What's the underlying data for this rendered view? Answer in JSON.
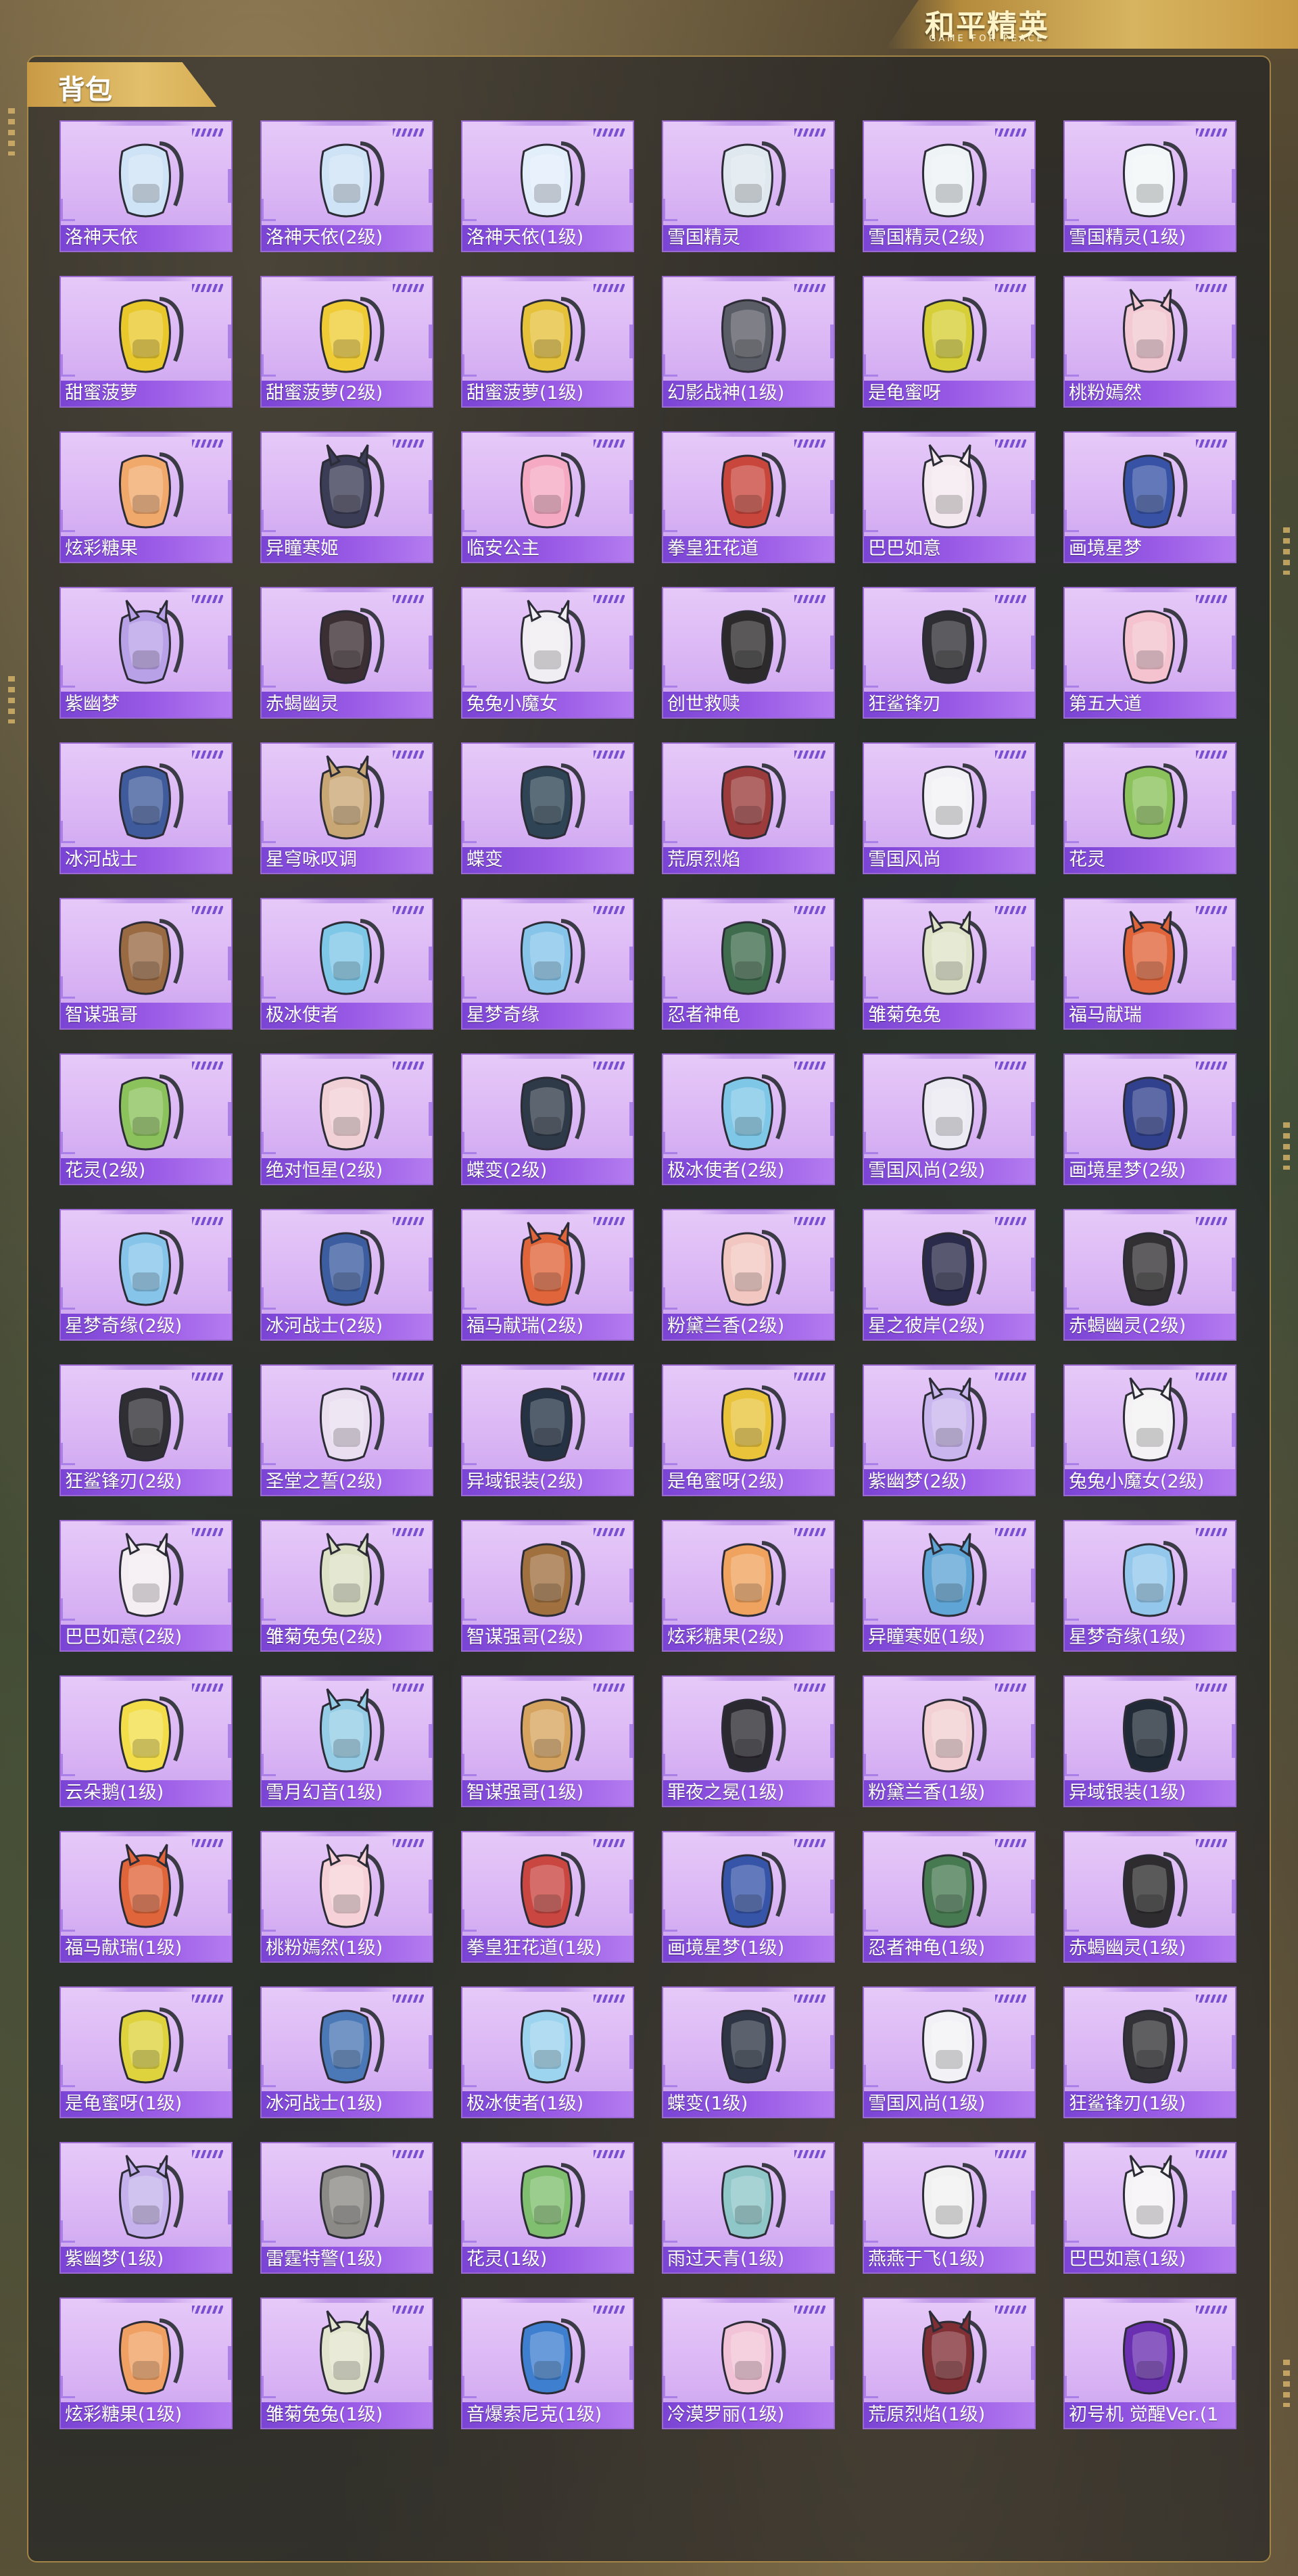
{
  "brand": {
    "title": "和平精英",
    "subtitle": "GAME FOR PEACE"
  },
  "section": {
    "title": "背包"
  },
  "colors": {
    "card_bg": "#dcb8f5",
    "label_bg": "#8a4fdc",
    "accent_gold": "#d6b25c"
  },
  "items": [
    {
      "name": "洛神天依",
      "icon": "backpack-icon",
      "color": "#cfe3f6"
    },
    {
      "name": "洛神天依(2级)",
      "icon": "backpack-icon",
      "color": "#cfe3f6"
    },
    {
      "name": "洛神天依(1级)",
      "icon": "backpack-icon",
      "color": "#e3eefb"
    },
    {
      "name": "雪国精灵",
      "icon": "snowman-backpack-icon",
      "color": "#dfe8ef"
    },
    {
      "name": "雪国精灵(2级)",
      "icon": "snowman-backpack-icon",
      "color": "#eef3f6"
    },
    {
      "name": "雪国精灵(1级)",
      "icon": "snowman-backpack-icon",
      "color": "#f3f6f8"
    },
    {
      "name": "甜蜜菠萝",
      "icon": "pineapple-backpack-icon",
      "color": "#e9c82b"
    },
    {
      "name": "甜蜜菠萝(2级)",
      "icon": "pineapple-backpack-icon",
      "color": "#efcc35"
    },
    {
      "name": "甜蜜菠萝(1级)",
      "icon": "pineapple-backpack-icon",
      "color": "#e6c13a"
    },
    {
      "name": "幻影战神(1级)",
      "icon": "backpack-icon",
      "color": "#5b5d66"
    },
    {
      "name": "是龟蜜呀",
      "icon": "turtle-backpack-icon",
      "color": "#d6cf37"
    },
    {
      "name": "桃粉嫣然",
      "icon": "bunny-backpack-icon",
      "color": "#f3c9d3"
    },
    {
      "name": "炫彩糖果",
      "icon": "donut-backpack-icon",
      "color": "#f1a86b"
    },
    {
      "name": "异瞳寒姬",
      "icon": "bunny-backpack-icon",
      "color": "#3b3c55"
    },
    {
      "name": "临安公主",
      "icon": "flower-backpack-icon",
      "color": "#f5a9c3"
    },
    {
      "name": "拳皇狂花道",
      "icon": "warrior-backpack-icon",
      "color": "#c9463c"
    },
    {
      "name": "巴巴如意",
      "icon": "cat-backpack-icon",
      "color": "#f4e9ef"
    },
    {
      "name": "画境星梦",
      "icon": "frame-backpack-icon",
      "color": "#3853a6"
    },
    {
      "name": "紫幽梦",
      "icon": "bunny-backpack-icon",
      "color": "#b9a1e8"
    },
    {
      "name": "赤蝎幽灵",
      "icon": "backpack-icon",
      "color": "#3b2f34"
    },
    {
      "name": "兔兔小魔女",
      "icon": "bunny-backpack-icon",
      "color": "#f1eef3"
    },
    {
      "name": "创世救赎",
      "icon": "armor-backpack-icon",
      "color": "#2c2a2a"
    },
    {
      "name": "狂鲨锋刃",
      "icon": "shark-backpack-icon",
      "color": "#2f2e33"
    },
    {
      "name": "第五大道",
      "icon": "handbag-icon",
      "color": "#f4c3cf"
    },
    {
      "name": "冰河战士",
      "icon": "backpack-icon",
      "color": "#3f5b9c"
    },
    {
      "name": "星穹咏叹调",
      "icon": "bunny-backpack-icon",
      "color": "#c9a775"
    },
    {
      "name": "蝶变",
      "icon": "backpack-icon",
      "color": "#2f4455"
    },
    {
      "name": "荒原烈焰",
      "icon": "backpack-icon",
      "color": "#9b3b3b"
    },
    {
      "name": "雪国风尚",
      "icon": "penguin-backpack-icon",
      "color": "#f2f2f6"
    },
    {
      "name": "花灵",
      "icon": "frog-backpack-icon",
      "color": "#8bc25c"
    },
    {
      "name": "智谋强哥",
      "icon": "bear-backpack-icon",
      "color": "#9a6a43"
    },
    {
      "name": "极冰使者",
      "icon": "ice-backpack-icon",
      "color": "#7fc7e7"
    },
    {
      "name": "星梦奇缘",
      "icon": "swan-backpack-icon",
      "color": "#86c4ea"
    },
    {
      "name": "忍者神龟",
      "icon": "turtle-backpack-icon",
      "color": "#3f6c4d"
    },
    {
      "name": "雏菊兔兔",
      "icon": "bunny-backpack-icon",
      "color": "#dfe3c8"
    },
    {
      "name": "福马献瑞",
      "icon": "horse-backpack-icon",
      "color": "#e0653a"
    },
    {
      "name": "花灵(2级)",
      "icon": "frog-backpack-icon",
      "color": "#8bc25c"
    },
    {
      "name": "绝对恒星(2级)",
      "icon": "popcorn-backpack-icon",
      "color": "#f2d1d6"
    },
    {
      "name": "蝶变(2级)",
      "icon": "backpack-icon",
      "color": "#2f3a48"
    },
    {
      "name": "极冰使者(2级)",
      "icon": "ice-backpack-icon",
      "color": "#7fc7e7"
    },
    {
      "name": "雪国风尚(2级)",
      "icon": "penguin-backpack-icon",
      "color": "#eceaf3"
    },
    {
      "name": "画境星梦(2级)",
      "icon": "frame-backpack-icon",
      "color": "#31418d"
    },
    {
      "name": "星梦奇缘(2级)",
      "icon": "swan-backpack-icon",
      "color": "#86c4ea"
    },
    {
      "name": "冰河战士(2级)",
      "icon": "backpack-icon",
      "color": "#3c5da0"
    },
    {
      "name": "福马献瑞(2级)",
      "icon": "horse-backpack-icon",
      "color": "#e0653a"
    },
    {
      "name": "粉黛兰香(2级)",
      "icon": "shell-backpack-icon",
      "color": "#f2c7c2"
    },
    {
      "name": "星之彼岸(2级)",
      "icon": "backpack-icon",
      "color": "#2a2a4a"
    },
    {
      "name": "赤蝎幽灵(2级)",
      "icon": "backpack-icon",
      "color": "#333033"
    },
    {
      "name": "狂鲨锋刃(2级)",
      "icon": "shark-backpack-icon",
      "color": "#2f2e33"
    },
    {
      "name": "圣堂之誓(2级)",
      "icon": "heart-backpack-icon",
      "color": "#eadff0"
    },
    {
      "name": "异域银装(2级)",
      "icon": "backpack-icon",
      "color": "#253244"
    },
    {
      "name": "是龟蜜呀(2级)",
      "icon": "turtle-backpack-icon",
      "color": "#e9c43b"
    },
    {
      "name": "紫幽梦(2级)",
      "icon": "bunny-backpack-icon",
      "color": "#c9b6ee"
    },
    {
      "name": "兔兔小魔女(2级)",
      "icon": "bunny-backpack-icon",
      "color": "#f4f2f4"
    },
    {
      "name": "巴巴如意(2级)",
      "icon": "cat-backpack-icon",
      "color": "#f4eef2"
    },
    {
      "name": "雏菊兔兔(2级)",
      "icon": "bunny-backpack-icon",
      "color": "#dde1c6"
    },
    {
      "name": "智谋强哥(2级)",
      "icon": "bear-backpack-icon",
      "color": "#a0703f"
    },
    {
      "name": "炫彩糖果(2级)",
      "icon": "donut-backpack-icon",
      "color": "#f0a35f"
    },
    {
      "name": "异瞳寒姬(1级)",
      "icon": "bunny-backpack-icon",
      "color": "#5fa5d5"
    },
    {
      "name": "星梦奇缘(1级)",
      "icon": "swan-backpack-icon",
      "color": "#93c8ec"
    },
    {
      "name": "云朵鹅(1级)",
      "icon": "flower-backpack-icon",
      "color": "#f3de4a"
    },
    {
      "name": "雪月幻音(1级)",
      "icon": "bunny-backpack-icon",
      "color": "#95cde6"
    },
    {
      "name": "智谋强哥(1级)",
      "icon": "bear-backpack-icon",
      "color": "#d7a45f"
    },
    {
      "name": "罪夜之冕(1级)",
      "icon": "spider-backpack-icon",
      "color": "#2b2930"
    },
    {
      "name": "粉黛兰香(1级)",
      "icon": "shell-backpack-icon",
      "color": "#f3d0d3"
    },
    {
      "name": "异域银装(1级)",
      "icon": "backpack-icon",
      "color": "#1f2a36"
    },
    {
      "name": "福马献瑞(1级)",
      "icon": "horse-backpack-icon",
      "color": "#e0653a"
    },
    {
      "name": "桃粉嫣然(1级)",
      "icon": "bunny-backpack-icon",
      "color": "#f6d2d8"
    },
    {
      "name": "拳皇狂花道(1级)",
      "icon": "warrior-backpack-icon",
      "color": "#c94641"
    },
    {
      "name": "画境星梦(1级)",
      "icon": "frame-backpack-icon",
      "color": "#3655a9"
    },
    {
      "name": "忍者神龟(1级)",
      "icon": "turtle-backpack-icon",
      "color": "#487a52"
    },
    {
      "name": "赤蝎幽灵(1级)",
      "icon": "backpack-icon",
      "color": "#2e2c2e"
    },
    {
      "name": "是龟蜜呀(1级)",
      "icon": "turtle-backpack-icon",
      "color": "#ded33d"
    },
    {
      "name": "冰河战士(1级)",
      "icon": "backpack-icon",
      "color": "#4b78b6"
    },
    {
      "name": "极冰使者(1级)",
      "icon": "ice-backpack-icon",
      "color": "#9cd3ee"
    },
    {
      "name": "蝶变(1级)",
      "icon": "backpack-icon",
      "color": "#2e3645"
    },
    {
      "name": "雪国风尚(1级)",
      "icon": "penguin-backpack-icon",
      "color": "#f2f2f6"
    },
    {
      "name": "狂鲨锋刃(1级)",
      "icon": "shark-backpack-icon",
      "color": "#333237"
    },
    {
      "name": "紫幽梦(1级)",
      "icon": "bunny-backpack-icon",
      "color": "#c5b2ec"
    },
    {
      "name": "雷霆特警(1级)",
      "icon": "backpack-icon",
      "color": "#8b8a86"
    },
    {
      "name": "花灵(1级)",
      "icon": "frog-backpack-icon",
      "color": "#7fbf6f"
    },
    {
      "name": "雨过天青(1级)",
      "icon": "pendant-backpack-icon",
      "color": "#8fc7c9"
    },
    {
      "name": "燕燕于飞(1级)",
      "icon": "camera-backpack-icon",
      "color": "#f1f1f1"
    },
    {
      "name": "巴巴如意(1级)",
      "icon": "cat-backpack-icon",
      "color": "#f6f3f6"
    },
    {
      "name": "炫彩糖果(1级)",
      "icon": "donut-backpack-icon",
      "color": "#f0a062"
    },
    {
      "name": "雏菊兔兔(1级)",
      "icon": "bunny-backpack-icon",
      "color": "#e3e4cd"
    },
    {
      "name": "音爆索尼克(1级)",
      "icon": "backpack-icon",
      "color": "#3f7fd0"
    },
    {
      "name": "冷漠罗丽(1级)",
      "icon": "heart-backpack-icon",
      "color": "#f2c3d6"
    },
    {
      "name": "荒原烈焰(1级)",
      "icon": "bunny-backpack-icon",
      "color": "#802f35"
    },
    {
      "name": "初号机 觉醒Ver.(1",
      "icon": "shield-backpack-icon",
      "color": "#6a2fb0"
    }
  ]
}
